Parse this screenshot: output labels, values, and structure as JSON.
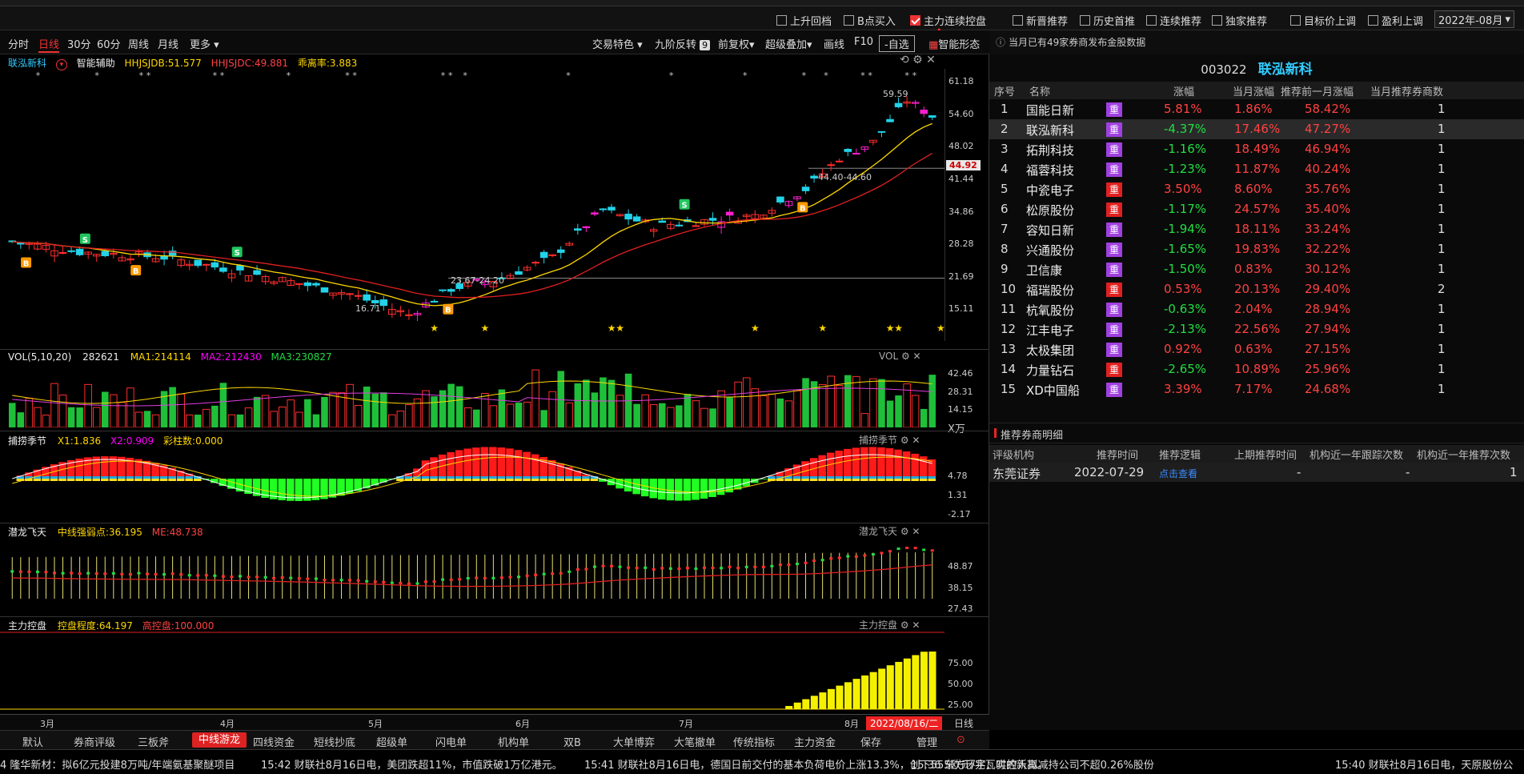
{
  "filters": [
    {
      "label": "上升回档",
      "checked": false
    },
    {
      "label": "B点买入",
      "checked": false
    },
    {
      "label": "主力连续控盘",
      "checked": true
    },
    {
      "label": "新晋推荐",
      "checked": false
    },
    {
      "label": "历史首推",
      "checked": false
    },
    {
      "label": "连续推荐",
      "checked": false
    },
    {
      "label": "独家推荐",
      "checked": false
    },
    {
      "label": "目标价上调",
      "checked": false
    },
    {
      "label": "盈利上调",
      "checked": false
    }
  ],
  "year_select": "2022年-08月",
  "chart_toolbar": {
    "periods": [
      "分时",
      "日线",
      "30分",
      "60分",
      "周线",
      "月线",
      "更多"
    ],
    "active_period": "日线",
    "tools": [
      "交易特色",
      "九阶反转",
      "前复权",
      "超级叠加",
      "画线",
      "F10",
      "-自选",
      "智能形态"
    ],
    "nine_badge": "9"
  },
  "main_panel": {
    "stock_name": "联泓新科",
    "assist": "智能辅助",
    "ind1": "HHJSJDB:51.577",
    "ind2": "HHJSJDC:49.881",
    "ind3": "乖离率:3.883",
    "y_ticks": [
      "61.18",
      "54.60",
      "48.02",
      "41.44",
      "34.86",
      "28.28",
      "21.69",
      "15.11"
    ],
    "current_price": "44.92",
    "high_label": "59.59",
    "low_label": "16.71",
    "range1": "44.40-44.60",
    "range2": "23.67-24.20"
  },
  "vol_panel": {
    "title": "VOL(5,10,20)",
    "value": "282621",
    "ma1": "MA1:214114",
    "ma2": "MA2:212430",
    "ma3": "MA3:230827",
    "tag": "VOL",
    "y_ticks": [
      "42.46",
      "28.31",
      "14.15"
    ],
    "unit": "X万"
  },
  "season_panel": {
    "title": "捕捞季节",
    "x1": "X1:1.836",
    "x2": "X2:0.909",
    "bars": "彩柱数:0.000",
    "tag": "捕捞季节",
    "y_ticks": [
      "4.78",
      "1.31",
      "-2.17"
    ]
  },
  "dragon_panel": {
    "title": "潜龙飞天",
    "mid": "中线强弱点:36.195",
    "me": "ME:48.738",
    "tag": "潜龙飞天",
    "y_ticks": [
      "48.87",
      "38.15",
      "27.43"
    ]
  },
  "control_panel": {
    "title": "主力控盘",
    "degree": "控盘程度:64.197",
    "high": "高控盘:100.000",
    "tag": "主力控盘",
    "y_ticks": [
      "75.00",
      "50.00",
      "25.00"
    ]
  },
  "x_axis": {
    "months": [
      "3月",
      "4月",
      "5月",
      "6月",
      "7月",
      "8月"
    ],
    "date_box": "2022/08/16/二",
    "daily": "日线"
  },
  "right_panel": {
    "notice": "当月已有49家券商发布金股数据",
    "code": "003022",
    "name": "联泓新科",
    "headers": [
      "序号",
      "名称",
      "涨幅",
      "当月涨幅",
      "推荐前一月涨幅",
      "当月推荐券商数"
    ],
    "rows": [
      {
        "no": "1",
        "name": "国能日新",
        "badge": "重",
        "badge_color": "#a040e0",
        "chg": "5.81%",
        "chg_dir": "up",
        "month": "1.86%",
        "prev": "58.42%",
        "brokers": "1"
      },
      {
        "no": "2",
        "name": "联泓新科",
        "badge": "重",
        "badge_color": "#a040e0",
        "chg": "-4.37%",
        "chg_dir": "down",
        "month": "17.46%",
        "prev": "47.27%",
        "brokers": "1"
      },
      {
        "no": "3",
        "name": "拓荆科技",
        "badge": "重",
        "badge_color": "#a040e0",
        "chg": "-1.16%",
        "chg_dir": "down",
        "month": "18.49%",
        "prev": "46.94%",
        "brokers": "1"
      },
      {
        "no": "4",
        "name": "福蓉科技",
        "badge": "重",
        "badge_color": "#a040e0",
        "chg": "-1.23%",
        "chg_dir": "down",
        "month": "11.87%",
        "prev": "40.24%",
        "brokers": "1"
      },
      {
        "no": "5",
        "name": "中瓷电子",
        "badge": "重",
        "badge_color": "#e02020",
        "chg": "3.50%",
        "chg_dir": "up",
        "month": "8.60%",
        "prev": "35.76%",
        "brokers": "1"
      },
      {
        "no": "6",
        "name": "松原股份",
        "badge": "重",
        "badge_color": "#e02020",
        "chg": "-1.17%",
        "chg_dir": "down",
        "month": "24.57%",
        "prev": "35.40%",
        "brokers": "1"
      },
      {
        "no": "7",
        "name": "容知日新",
        "badge": "重",
        "badge_color": "#a040e0",
        "chg": "-1.94%",
        "chg_dir": "down",
        "month": "18.11%",
        "prev": "33.24%",
        "brokers": "1"
      },
      {
        "no": "8",
        "name": "兴通股份",
        "badge": "重",
        "badge_color": "#a040e0",
        "chg": "-1.65%",
        "chg_dir": "down",
        "month": "19.83%",
        "prev": "32.22%",
        "brokers": "1"
      },
      {
        "no": "9",
        "name": "卫信康",
        "badge": "重",
        "badge_color": "#a040e0",
        "chg": "-1.50%",
        "chg_dir": "down",
        "month": "0.83%",
        "prev": "30.12%",
        "brokers": "1"
      },
      {
        "no": "10",
        "name": "福瑞股份",
        "badge": "重",
        "badge_color": "#e02020",
        "chg": "0.53%",
        "chg_dir": "up",
        "month": "20.13%",
        "prev": "29.40%",
        "brokers": "2"
      },
      {
        "no": "11",
        "name": "杭氧股份",
        "badge": "重",
        "badge_color": "#a040e0",
        "chg": "-0.63%",
        "chg_dir": "down",
        "month": "2.04%",
        "prev": "28.94%",
        "brokers": "1"
      },
      {
        "no": "12",
        "name": "江丰电子",
        "badge": "重",
        "badge_color": "#a040e0",
        "chg": "-2.13%",
        "chg_dir": "down",
        "month": "22.56%",
        "prev": "27.94%",
        "brokers": "1"
      },
      {
        "no": "13",
        "name": "太极集团",
        "badge": "重",
        "badge_color": "#a040e0",
        "chg": "0.92%",
        "chg_dir": "up",
        "month": "0.63%",
        "prev": "27.15%",
        "brokers": "1"
      },
      {
        "no": "14",
        "name": "力量钻石",
        "badge": "重",
        "badge_color": "#e02020",
        "chg": "-2.65%",
        "chg_dir": "down",
        "month": "10.89%",
        "prev": "25.96%",
        "brokers": "1"
      },
      {
        "no": "15",
        "name": "XD中国船",
        "badge": "重",
        "badge_color": "#a040e0",
        "chg": "3.39%",
        "chg_dir": "up",
        "month": "7.17%",
        "prev": "24.68%",
        "brokers": "1"
      }
    ],
    "detail_title": "推荐券商明细",
    "detail_headers": [
      "评级机构",
      "推荐时间",
      "推荐逻辑",
      "上期推荐时间",
      "机构近一年跟踪次数",
      "机构近一年推荐次数"
    ],
    "detail_row": {
      "org": "东莞证券",
      "time": "2022-07-29",
      "logic": "点击查看",
      "prev": "-",
      "track": "-",
      "rec": "1"
    }
  },
  "bottom_tabs": [
    "默认",
    "券商评级",
    "三板斧",
    "中线游龙",
    "四线资金",
    "短线抄底",
    "超级单",
    "闪电单",
    "机构单",
    "双B",
    "大单博弈",
    "大笔撤单",
    "传统指标",
    "主力资金",
    "保存",
    "管理"
  ],
  "active_tab": "中线游龙",
  "ticker": [
    "4 隆华新材：拟6亿元投建8万吨/年端氨基聚醚项目",
    "15:42 财联社8月16日电，美团跌超11%，市值跌破1万亿港元。",
    "15:41 财联社8月16日电，德国日前交付的基本负荷电价上涨13.3%，创下555欧元/兆瓦时的新高。",
    "15:36 东方环宇：实控人拟减持公司不超0.26%股份",
    "15:40 财联社8月16日电，天原股份公"
  ]
}
